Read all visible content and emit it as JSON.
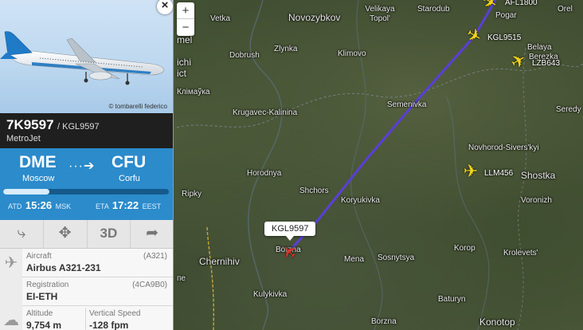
{
  "map": {
    "zoom_in": "+",
    "zoom_out": "−",
    "towns": [
      {
        "id": "orel",
        "text": "Orel"
      },
      {
        "id": "vetka",
        "text": "Vetka"
      },
      {
        "id": "novozybkov",
        "text": "Novozybkov"
      },
      {
        "id": "velikaya_topol",
        "text": "Velikaya\nTopol'"
      },
      {
        "id": "starodub",
        "text": "Starodub"
      },
      {
        "id": "pogar",
        "text": "Pogar"
      },
      {
        "id": "mel",
        "text": "mel"
      },
      {
        "id": "dobrush",
        "text": "Dobrush"
      },
      {
        "id": "zlynka",
        "text": "Zlynka"
      },
      {
        "id": "klimovo",
        "text": "Klimovo"
      },
      {
        "id": "belaya",
        "text": "Belaya"
      },
      {
        "id": "berezka",
        "text": "Berezka"
      },
      {
        "id": "lichi",
        "text": "ichi"
      },
      {
        "id": "ict",
        "text": "ict"
      },
      {
        "id": "klimauka",
        "text": "Клімаўка"
      },
      {
        "id": "semenivka",
        "text": "Semenivka"
      },
      {
        "id": "krugavec",
        "text": "Krugavec-Kalinina"
      },
      {
        "id": "seredy",
        "text": "Seredy"
      },
      {
        "id": "novhorod",
        "text": "Novhorod-Sivers'kyi"
      },
      {
        "id": "horodnya",
        "text": "Horodnya"
      },
      {
        "id": "shostka",
        "text": "Shostka"
      },
      {
        "id": "voronizh",
        "text": "Voronizh"
      },
      {
        "id": "ripky",
        "text": "Ripky"
      },
      {
        "id": "shchors",
        "text": "Shchors"
      },
      {
        "id": "koryukivka",
        "text": "Koryukivka"
      },
      {
        "id": "chernihiv",
        "text": "Chernihiv"
      },
      {
        "id": "borzna1",
        "text": "Borzna"
      },
      {
        "id": "mena",
        "text": "Mena"
      },
      {
        "id": "sosnytsya",
        "text": "Sosnytsya"
      },
      {
        "id": "korop",
        "text": "Korop"
      },
      {
        "id": "krolevets",
        "text": "Krolevets'"
      },
      {
        "id": "kulykivka",
        "text": "Kulykivka"
      },
      {
        "id": "baturyn",
        "text": "Baturyn"
      },
      {
        "id": "borzna2",
        "text": "Borzna"
      },
      {
        "id": "konotop",
        "text": "Konotop"
      },
      {
        "id": "pe",
        "text": "пе"
      }
    ],
    "planes": [
      {
        "id": "afl1800",
        "label": "AFL1800"
      },
      {
        "id": "kgl9515",
        "label": "KGL9515"
      },
      {
        "id": "lzb643",
        "label": "LZB643"
      },
      {
        "id": "llm456",
        "label": "LLM456"
      }
    ],
    "selected_label": "KGL9597",
    "track_color": "#5a3fd6"
  },
  "panel": {
    "close": "×",
    "photo_credit": "© tombarelli federico",
    "flight_number": "7K9597",
    "callsign": "/ KGL9597",
    "airline": "MetroJet",
    "origin_code": "DME",
    "origin_city": "Moscow",
    "dest_code": "CFU",
    "dest_city": "Corfu",
    "arrow": "···➔",
    "progress": 0.28,
    "atd_label": "ATD",
    "atd_time": "15:26",
    "atd_tz": "MSK",
    "eta_label": "ETA",
    "eta_time": "17:22",
    "eta_tz": "EEST",
    "actions": {
      "route_icon": "route-icon",
      "fit_icon": "fit-icon",
      "view3d": "3D",
      "share_icon": "share-icon"
    },
    "aircraft_label": "Aircraft",
    "aircraft_code": "(A321)",
    "aircraft_value": "Airbus A321-231",
    "registration_label": "Registration",
    "registration_code": "(4CA9B0)",
    "registration_value": "EI-ETH",
    "altitude_label": "Altitude",
    "altitude_value": "9,754 m",
    "vspeed_label": "Vertical Speed",
    "vspeed_value": "-128 fpm"
  }
}
